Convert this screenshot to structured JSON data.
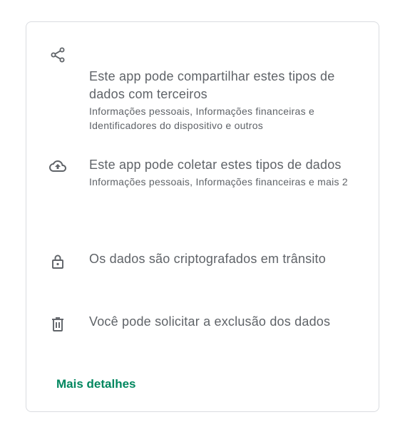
{
  "data_safety": {
    "items": [
      {
        "icon": "share-icon",
        "title": "Este app pode compartilhar estes tipos de dados com terceiros",
        "subtitle": "Informações pessoais, Informações financeiras e Identificadores do dispositivo e outros"
      },
      {
        "icon": "cloud-upload-icon",
        "title": "Este app pode coletar estes tipos de dados",
        "subtitle": "Informações pessoais, Informações financeiras e mais 2"
      },
      {
        "icon": "lock-icon",
        "title": "Os dados são criptografados em trânsito"
      },
      {
        "icon": "trash-icon",
        "title": "Você pode solicitar a exclusão dos dados"
      }
    ],
    "more_details_label": "Mais detalhes"
  },
  "colors": {
    "text": "#5f6368",
    "link": "#01875f",
    "border": "#dadce0"
  }
}
